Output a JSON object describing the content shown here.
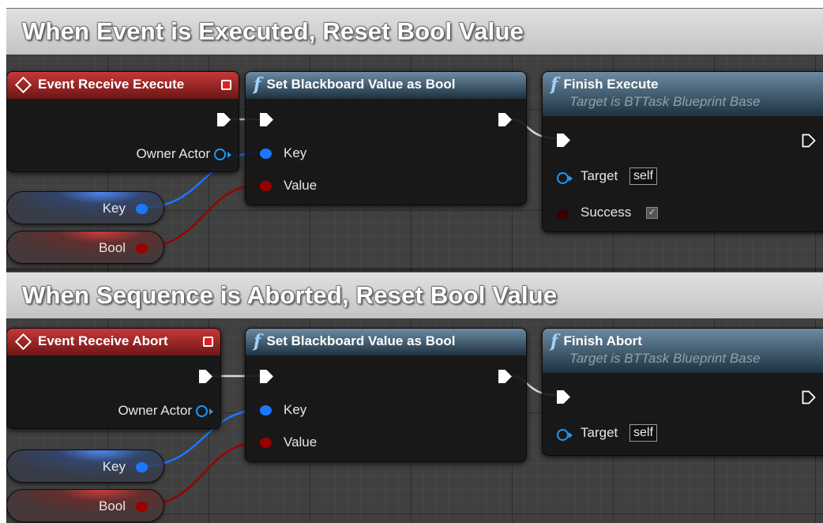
{
  "comments": [
    {
      "title": "When Event is Executed, Reset Bool Value"
    },
    {
      "title": "When Sequence is Aborted, Reset Bool Value"
    }
  ],
  "section1": {
    "event_node": {
      "title": "Event Receive Execute",
      "owner_label": "Owner Actor"
    },
    "set_node": {
      "title": "Set Blackboard Value as Bool",
      "key_label": "Key",
      "value_label": "Value"
    },
    "finish_node": {
      "title": "Finish Execute",
      "subtitle": "Target is BTTask Blueprint Base",
      "target_label": "Target",
      "target_value": "self",
      "success_label": "Success",
      "success_checked": "✓"
    },
    "key_var": {
      "label": "Key"
    },
    "bool_var": {
      "label": "Bool"
    }
  },
  "section2": {
    "event_node": {
      "title": "Event Receive Abort",
      "owner_label": "Owner Actor"
    },
    "set_node": {
      "title": "Set Blackboard Value as Bool",
      "key_label": "Key",
      "value_label": "Value"
    },
    "finish_node": {
      "title": "Finish Abort",
      "subtitle": "Target is BTTask Blueprint Base",
      "target_label": "Target",
      "target_value": "self"
    },
    "key_var": {
      "label": "Key"
    },
    "bool_var": {
      "label": "Bool"
    }
  },
  "icons": {
    "function": "f",
    "event": "diamond-icon",
    "delegate": "delegate-pin-icon",
    "exec": "exec-pin-icon",
    "object": "object-pin-icon"
  },
  "colors": {
    "event_header": "#a82a2a",
    "function_header": "#3d5a70",
    "object_pin": "#1a9aff",
    "key_pin": "#1a78ff",
    "bool_pin": "#9a0000",
    "grid": "#2b2b2b"
  }
}
